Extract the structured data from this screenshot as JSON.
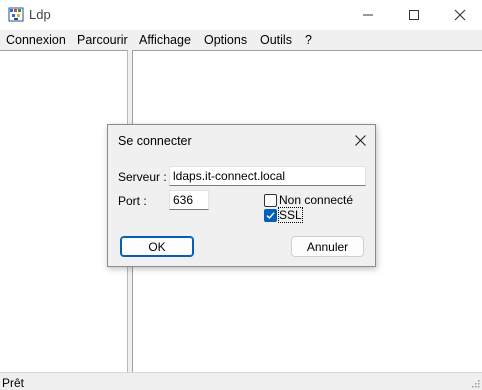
{
  "window": {
    "title": "Ldp",
    "icon": "ldp-app-icon",
    "controls": [
      "minimize-icon",
      "maximize-icon",
      "close-icon"
    ]
  },
  "menu": {
    "items": [
      "Connexion",
      "Parcourir",
      "Affichage",
      "Options",
      "Outils",
      "?"
    ]
  },
  "dialog": {
    "title": "Se connecter",
    "server_label": "Serveur :",
    "server_value": "ldaps.it-connect.local",
    "port_label": "Port :",
    "port_value": "636",
    "connectionless_label": "Non connecté",
    "connectionless_checked": false,
    "ssl_label": "SSL",
    "ssl_checked": true,
    "ok_label": "OK",
    "cancel_label": "Annuler"
  },
  "status": {
    "text": "Prêt"
  },
  "colors": {
    "accent": "#005fb8",
    "window_bg": "#f0f0f0",
    "pane_bg": "#ffffff"
  }
}
